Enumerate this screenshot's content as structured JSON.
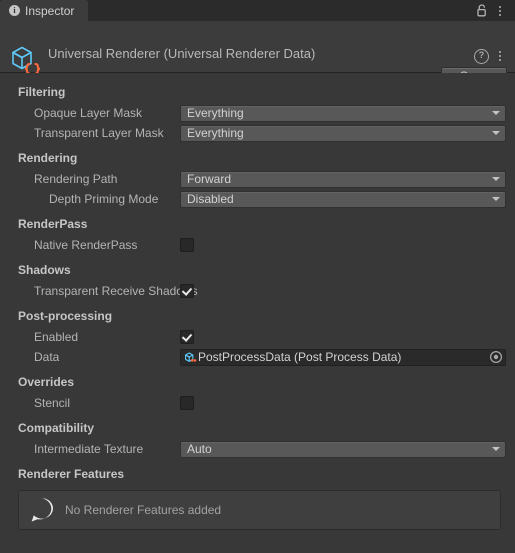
{
  "tabbar": {
    "tab_label": "Inspector",
    "info_glyph": "i",
    "lock_icon_name": "lock-icon",
    "menu_icon_name": "kebab-menu-icon"
  },
  "header": {
    "title": "Universal Renderer (Universal Renderer Data)",
    "help_glyph": "?",
    "open_label": "Open"
  },
  "sections": {
    "filtering": {
      "title": "Filtering",
      "opaque_layer_mask": {
        "label": "Opaque Layer Mask",
        "value": "Everything"
      },
      "transparent_layer_mask": {
        "label": "Transparent Layer Mask",
        "value": "Everything"
      }
    },
    "rendering": {
      "title": "Rendering",
      "rendering_path": {
        "label": "Rendering Path",
        "value": "Forward"
      },
      "depth_priming_mode": {
        "label": "Depth Priming Mode",
        "value": "Disabled"
      }
    },
    "renderpass": {
      "title": "RenderPass",
      "native_renderpass": {
        "label": "Native RenderPass",
        "checked": false
      }
    },
    "shadows": {
      "title": "Shadows",
      "transparent_receive_shadows": {
        "label": "Transparent Receive Shadows",
        "checked": true
      }
    },
    "postprocessing": {
      "title": "Post-processing",
      "enabled": {
        "label": "Enabled",
        "checked": true
      },
      "data": {
        "label": "Data",
        "value": "PostProcessData (Post Process Data)"
      }
    },
    "overrides": {
      "title": "Overrides",
      "stencil": {
        "label": "Stencil",
        "checked": false
      }
    },
    "compatibility": {
      "title": "Compatibility",
      "intermediate_texture": {
        "label": "Intermediate Texture",
        "value": "Auto"
      }
    },
    "renderer_features": {
      "title": "Renderer Features",
      "empty_message": "No Renderer Features added"
    }
  },
  "colors": {
    "window_bg": "#383838",
    "tabbar_bg": "#2b2b2b",
    "tab_active_bg": "#3c3c3c",
    "field_bg": "#585858",
    "objfield_bg": "#2a2a2a",
    "text": "#b4b4b4",
    "icon_blue": "#5fc9f8",
    "icon_orange": "#ff6a3d"
  }
}
